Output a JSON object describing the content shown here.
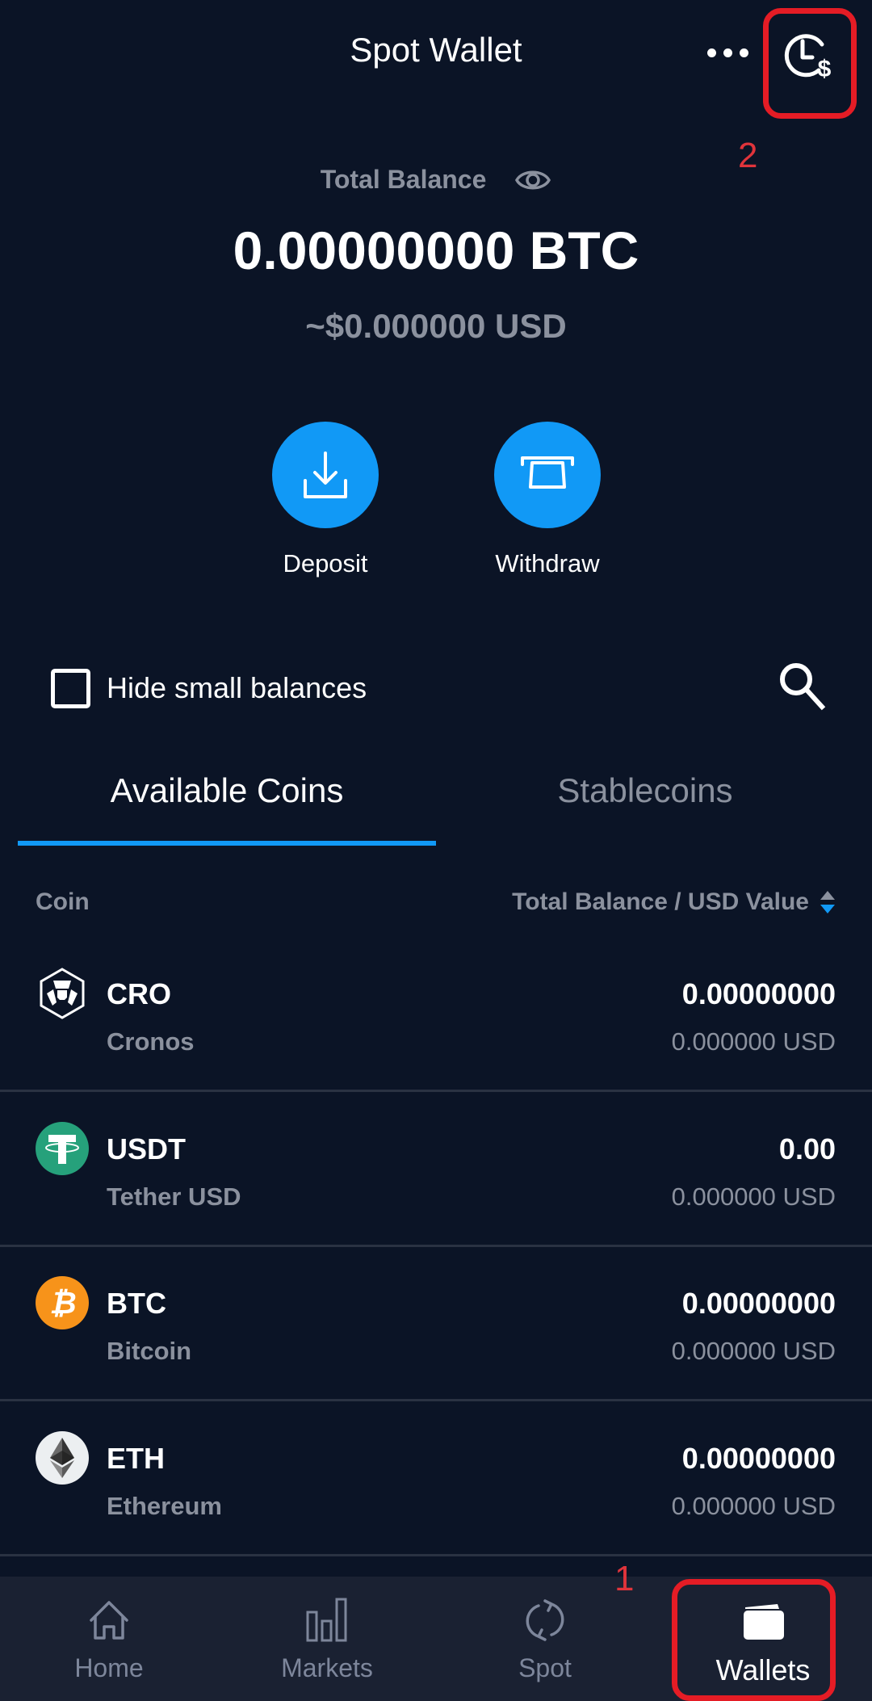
{
  "header": {
    "title": "Spot Wallet",
    "more_icon": "more-horizontal-icon",
    "history_icon": "clock-dollar-history-icon"
  },
  "balance": {
    "label": "Total Balance",
    "visibility_icon": "eye-icon",
    "btc_amount": "0.00000000 BTC",
    "usd_amount": "~$0.000000 USD"
  },
  "actions": [
    {
      "label": "Deposit",
      "icon": "download-icon"
    },
    {
      "label": "Withdraw",
      "icon": "atm-withdraw-icon"
    }
  ],
  "filter": {
    "hide_small_label": "Hide small balances",
    "hide_small_checked": false,
    "search_icon": "search-icon"
  },
  "tabs": [
    {
      "label": "Available Coins",
      "active": true
    },
    {
      "label": "Stablecoins",
      "active": false
    }
  ],
  "table": {
    "col_coin": "Coin",
    "col_balance": "Total Balance / USD Value",
    "rows": [
      {
        "symbol": "CRO",
        "name": "Cronos",
        "balance": "0.00000000",
        "usd": "0.000000 USD",
        "icon": "cronos-icon"
      },
      {
        "symbol": "USDT",
        "name": "Tether USD",
        "balance": "0.00",
        "usd": "0.000000 USD",
        "icon": "tether-icon"
      },
      {
        "symbol": "BTC",
        "name": "Bitcoin",
        "balance": "0.00000000",
        "usd": "0.000000 USD",
        "icon": "bitcoin-icon"
      },
      {
        "symbol": "ETH",
        "name": "Ethereum",
        "balance": "0.00000000",
        "usd": "0.000000 USD",
        "icon": "ethereum-icon"
      }
    ]
  },
  "nav": [
    {
      "label": "Home",
      "icon": "home-icon",
      "active": false
    },
    {
      "label": "Markets",
      "icon": "bar-chart-icon",
      "active": false
    },
    {
      "label": "Spot",
      "icon": "swap-cycle-icon",
      "active": false
    },
    {
      "label": "Wallets",
      "icon": "wallet-icon",
      "active": true
    }
  ],
  "annotations": [
    {
      "number": "1",
      "target": "Wallets"
    },
    {
      "number": "2",
      "target": "history"
    }
  ],
  "colors": {
    "background": "#0b1426",
    "accent": "#1199f6",
    "nav_background": "#1a2132",
    "annotation_red": "#e51c25",
    "muted_text": "#8b919e",
    "tether_green": "#26a17b",
    "bitcoin_orange": "#f7931a"
  }
}
